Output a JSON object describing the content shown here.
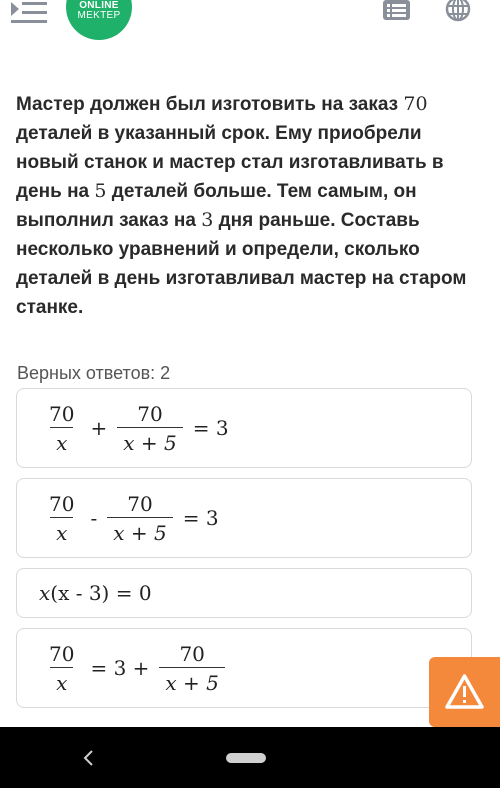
{
  "header": {
    "logo_line1": "ONLINE",
    "logo_line2": "MEKTEP"
  },
  "question": {
    "parts": [
      "Мастер должен был изготовить на заказ ",
      "70",
      " деталей в указанный срок. Ему приобрели новый станок и мастер стал изготавливать в день на ",
      "5",
      " деталей больше. Тем самым, он выполнил заказ на ",
      "3",
      " дня раньше. Составь несколько уравнений и определи, сколько деталей в день изготавливал мастер на старом станке."
    ]
  },
  "correct_answers_label": "Верных ответов: 2",
  "options": [
    {
      "n1": "70",
      "d1": "x",
      "op": "+",
      "n2": "70",
      "d2": "x + 5",
      "eq": "= 3"
    },
    {
      "n1": "70",
      "d1": "x",
      "op": "-",
      "n2": "70",
      "d2": "x + 5",
      "eq": "= 3"
    },
    {
      "expr_var": "x",
      "expr_rest": "(x - 3) = 0"
    },
    {
      "n1": "70",
      "d1": "x",
      "mid": "= 3 +",
      "n2": "70",
      "d2": "x + 5"
    }
  ],
  "colors": {
    "brand": "#1fb16a",
    "warning": "#f4883b",
    "icon": "#8a9099"
  },
  "icons": [
    "menu-icon",
    "list-icon",
    "globe-icon",
    "warning-icon",
    "back-icon",
    "home-icon"
  ]
}
